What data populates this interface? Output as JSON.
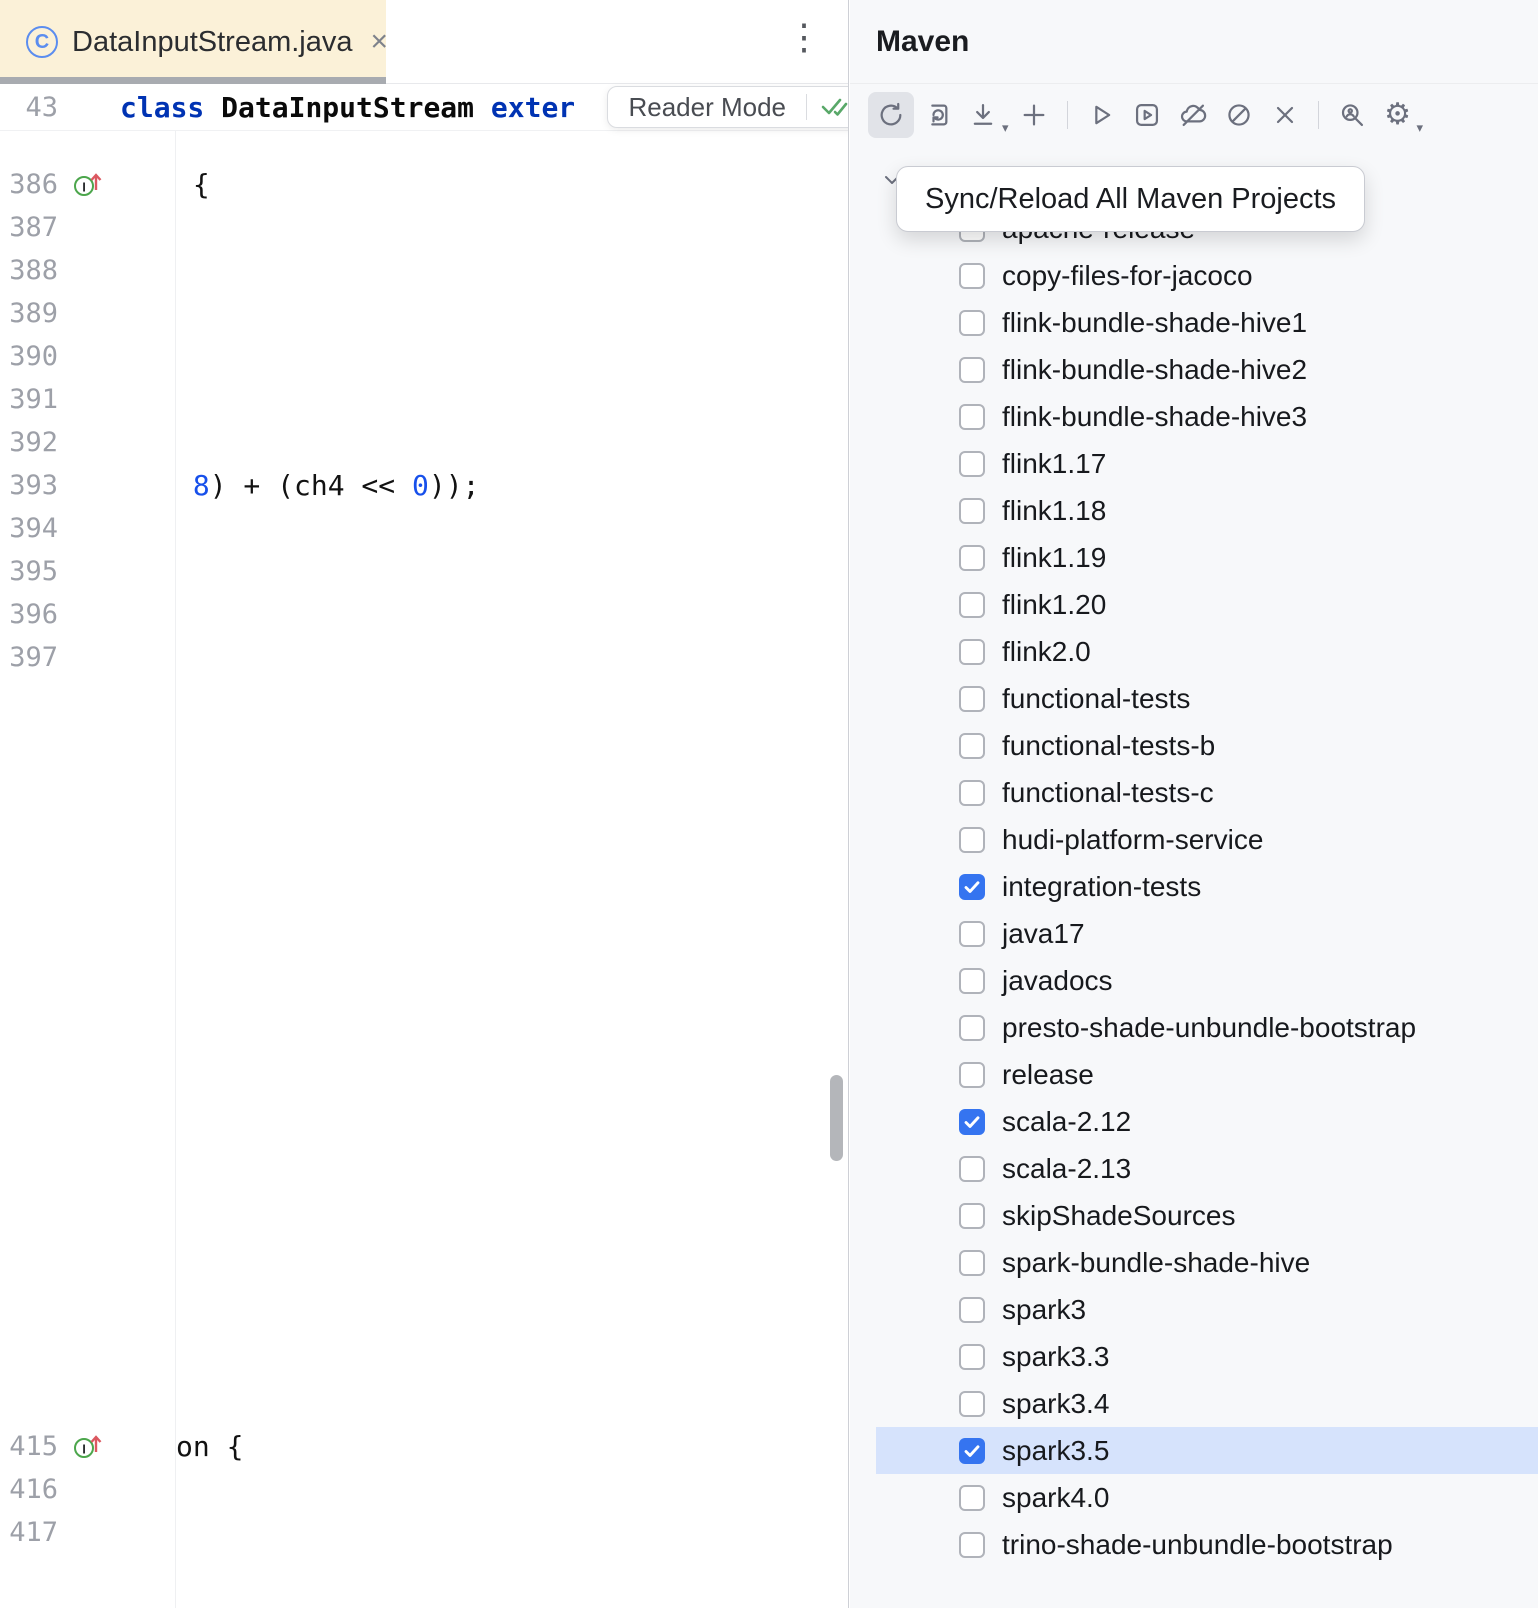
{
  "colors": {
    "accent": "#3574F0",
    "selection": "#D6E3FC",
    "tab_bg": "#FBF1D8",
    "keyword_blue": "#0033B3",
    "number_blue": "#1750EB",
    "success_green": "#59A869"
  },
  "icons": {
    "kebab": "⋮",
    "close": "×",
    "gear": "⚙",
    "dropdown": "▾",
    "class_letter": "C"
  },
  "editor": {
    "tab": {
      "title": "DataInputStream.java"
    },
    "sticky": {
      "line_number": "43",
      "segments": [
        {
          "t": "class ",
          "c": "kw"
        },
        {
          "t": "DataInputStream ",
          "c": "cls"
        },
        {
          "t": "exter",
          "c": "kw"
        }
      ]
    },
    "reader_mode_label": "Reader Mode",
    "lines_top": [
      {
        "num": "386",
        "icon": true,
        "code": [
          {
            "t": " {",
            "c": "p"
          }
        ]
      },
      {
        "num": "387"
      },
      {
        "num": "388"
      },
      {
        "num": "389"
      },
      {
        "num": "390"
      },
      {
        "num": "391"
      },
      {
        "num": "392"
      },
      {
        "num": "393",
        "code": [
          {
            "t": " ",
            "c": "p"
          },
          {
            "t": "8",
            "c": "num"
          },
          {
            "t": ") + (ch4 << ",
            "c": "p"
          },
          {
            "t": "0",
            "c": "num"
          },
          {
            "t": "));",
            "c": "p"
          }
        ]
      },
      {
        "num": "394"
      },
      {
        "num": "395"
      },
      {
        "num": "396"
      },
      {
        "num": "397"
      }
    ],
    "lines_bottom": [
      {
        "num": "415",
        "icon": true,
        "code": [
          {
            "t": "on {",
            "c": "p"
          }
        ]
      },
      {
        "num": "416"
      },
      {
        "num": "417"
      }
    ]
  },
  "maven": {
    "title": "Maven",
    "tooltip": "Sync/Reload All Maven Projects",
    "toolbar_buttons": [
      "sync-reload",
      "generate-sources",
      "download-sources",
      "add",
      "run",
      "execute-goal",
      "toggle-offline",
      "skip-tests",
      "close",
      "analyze-dependencies",
      "settings"
    ],
    "profiles": [
      {
        "label": "apache-release",
        "checked": false
      },
      {
        "label": "copy-files-for-jacoco",
        "checked": false
      },
      {
        "label": "flink-bundle-shade-hive1",
        "checked": false
      },
      {
        "label": "flink-bundle-shade-hive2",
        "checked": false
      },
      {
        "label": "flink-bundle-shade-hive3",
        "checked": false
      },
      {
        "label": "flink1.17",
        "checked": false
      },
      {
        "label": "flink1.18",
        "checked": false
      },
      {
        "label": "flink1.19",
        "checked": false
      },
      {
        "label": "flink1.20",
        "checked": false
      },
      {
        "label": "flink2.0",
        "checked": false
      },
      {
        "label": "functional-tests",
        "checked": false
      },
      {
        "label": "functional-tests-b",
        "checked": false
      },
      {
        "label": "functional-tests-c",
        "checked": false
      },
      {
        "label": "hudi-platform-service",
        "checked": false
      },
      {
        "label": "integration-tests",
        "checked": true
      },
      {
        "label": "java17",
        "checked": false
      },
      {
        "label": "javadocs",
        "checked": false
      },
      {
        "label": "presto-shade-unbundle-bootstrap",
        "checked": false
      },
      {
        "label": "release",
        "checked": false
      },
      {
        "label": "scala-2.12",
        "checked": true
      },
      {
        "label": "scala-2.13",
        "checked": false
      },
      {
        "label": "skipShadeSources",
        "checked": false
      },
      {
        "label": "spark-bundle-shade-hive",
        "checked": false
      },
      {
        "label": "spark3",
        "checked": false
      },
      {
        "label": "spark3.3",
        "checked": false
      },
      {
        "label": "spark3.4",
        "checked": false
      },
      {
        "label": "spark3.5",
        "checked": true,
        "selected": true
      },
      {
        "label": "spark4.0",
        "checked": false
      },
      {
        "label": "trino-shade-unbundle-bootstrap",
        "checked": false
      }
    ]
  }
}
